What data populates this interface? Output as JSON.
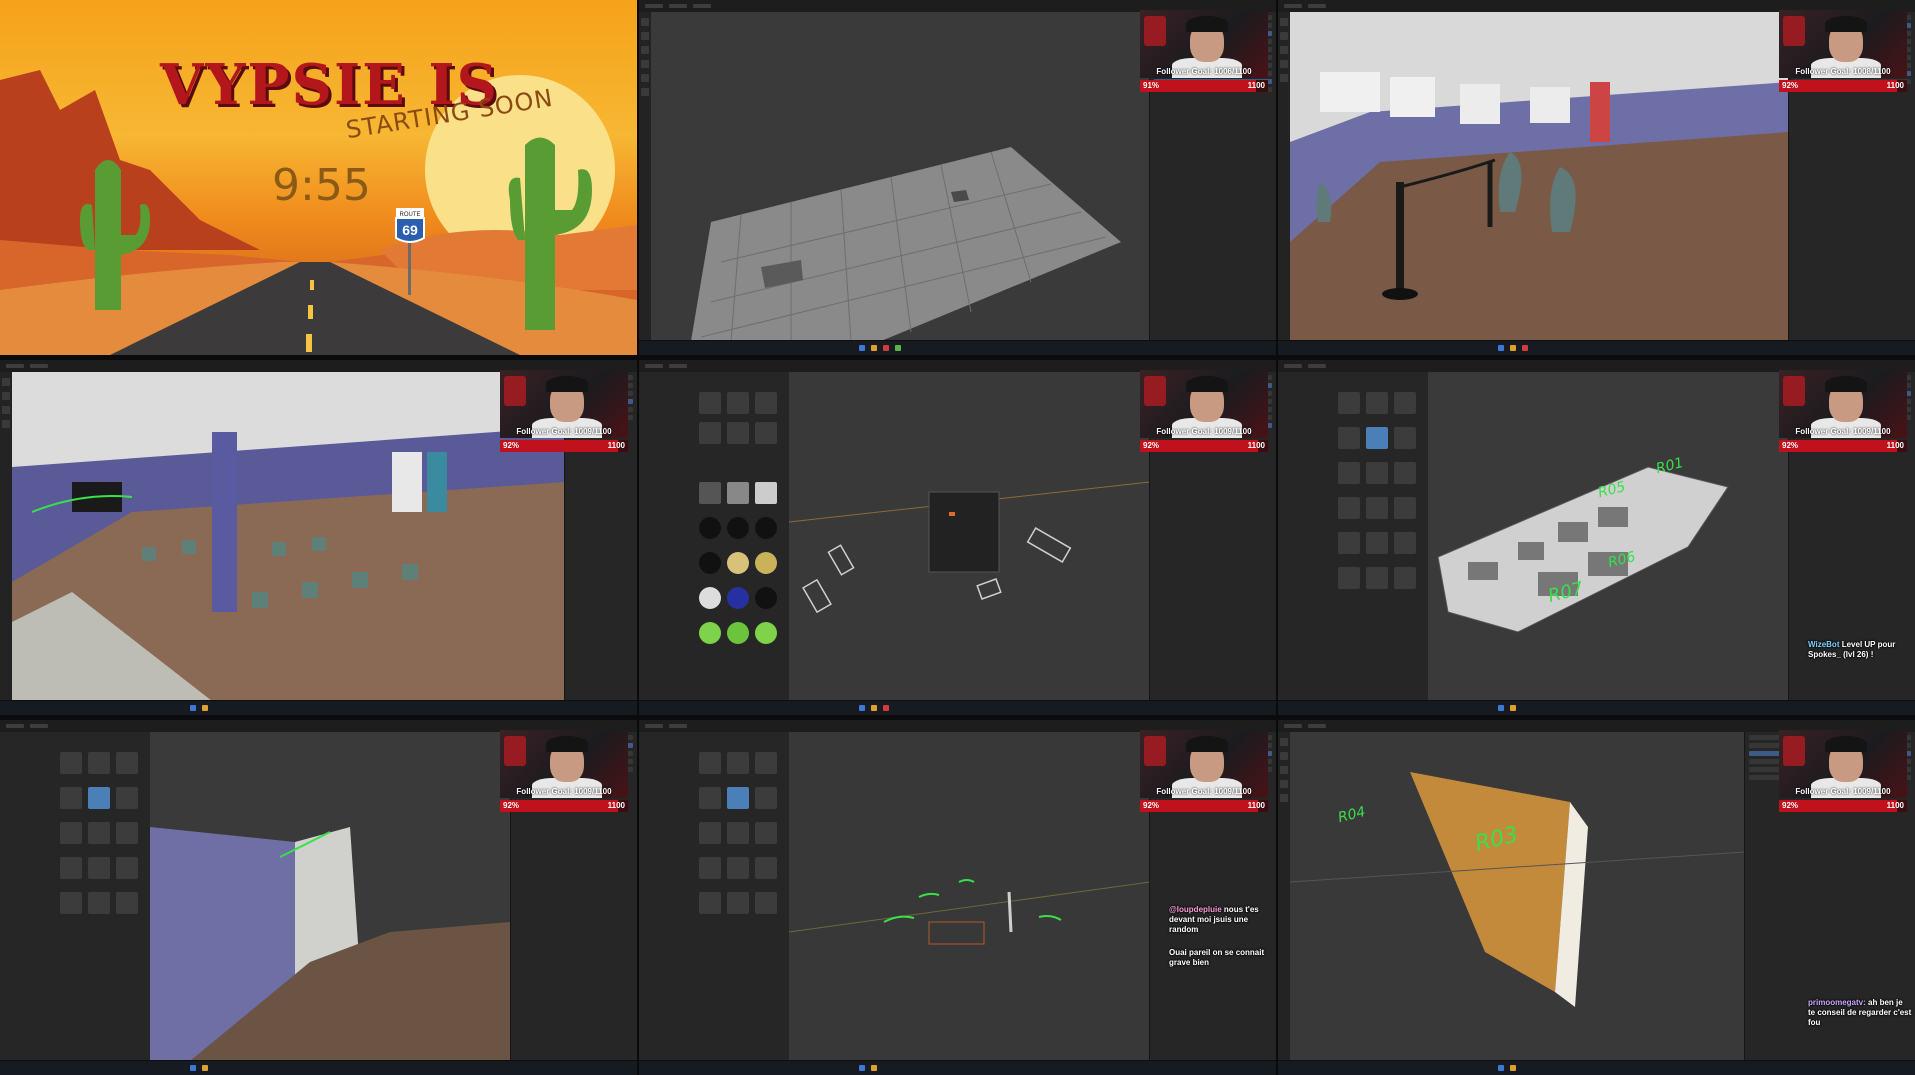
{
  "starting_soon": {
    "title": "VYPSIE IS",
    "subtitle": "STARTING SOON",
    "timer": "9:55",
    "route_label": "ROUTE",
    "route_number": "69"
  },
  "webcams": [
    {
      "goal_text": "Follower Goal: 1006/1100",
      "percent_label": "91%",
      "percent": 91,
      "target": "1100"
    },
    {
      "goal_text": "Follower Goal: 1008/1100",
      "percent_label": "92%",
      "percent": 92,
      "target": "1100"
    },
    {
      "goal_text": "Follower Goal: 1009/1100",
      "percent_label": "92%",
      "percent": 92,
      "target": "1100"
    },
    {
      "goal_text": "Follower Goal: 1009/1100",
      "percent_label": "92%",
      "percent": 92,
      "target": "1100"
    },
    {
      "goal_text": "Follower Goal: 1009/1100",
      "percent_label": "92%",
      "percent": 92,
      "target": "1100"
    },
    {
      "goal_text": "Follower Goal: 1009/1100",
      "percent_label": "92%",
      "percent": 92,
      "target": "1100"
    },
    {
      "goal_text": "Follower Goal: 1009/1100",
      "percent_label": "92%",
      "percent": 92,
      "target": "1100"
    },
    {
      "goal_text": "Follower Goal: 1009/1100",
      "percent_label": "92%",
      "percent": 92,
      "target": "1100"
    }
  ],
  "room_labels": {
    "r01": "R01",
    "r05": "R05",
    "r06": "R06",
    "r07": "R07",
    "r03": "R03",
    "r04": "R04"
  },
  "chat": {
    "levelup_user": "WizeBot",
    "levelup_text": "Level UP pour Spokes_ (lvl 26) !",
    "msg1_user": "@loupdepluie",
    "msg1_text": "nous t'es devant moi jsuis une random",
    "msg2_text": "Ouai pareil on se connait grave bien",
    "msg3_user": "primoomegatv:",
    "msg3_text": "ah ben je te conseil de regarder c'est fou"
  },
  "colors": {
    "accent_red": "#c0111c",
    "annotation_green": "#38e04a",
    "blender_bg": "#2a2a2a"
  }
}
